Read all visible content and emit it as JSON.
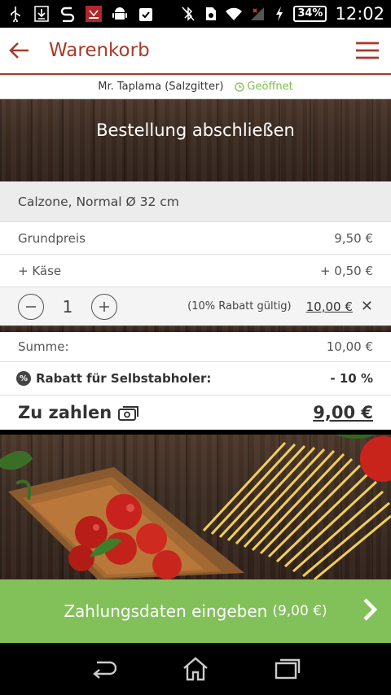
{
  "status_bar": {
    "left_icons": [
      "usb-icon",
      "download-icon",
      "s-app-icon",
      "app-logo-icon",
      "android-icon",
      "clipboard-check-icon"
    ],
    "battery": "34%",
    "time": "12:02"
  },
  "app_bar": {
    "title": "Warenkorb"
  },
  "store": {
    "name": "Mr. Taplama (Salzgitter)",
    "status": "Geöffnet"
  },
  "banner": {
    "title": "Bestellung abschließen"
  },
  "cart": {
    "item_name": "Calzone, Normal Ø 32 cm",
    "lines": [
      {
        "label": "Grundpreis",
        "value": "9,50 €"
      },
      {
        "label": "+ Käse",
        "value": "+ 0,50 €"
      }
    ],
    "quantity": "1",
    "rabatt_hint": "(10% Rabatt gültig)",
    "line_total": "10,00 €",
    "remove_symbol": "✕"
  },
  "summary": {
    "sum_label": "Summe:",
    "sum_value": "10,00 €",
    "discount_badge": "%",
    "discount_label": "Rabatt für Selbstabholer:",
    "discount_value": "- 10 %",
    "total_label": "Zu zahlen",
    "total_value": "9,00 €"
  },
  "cta": {
    "label": "Zahlungsdaten eingeben",
    "amount": "(9,00 €)"
  },
  "colors": {
    "brand": "#a83a2a",
    "cta": "#82c159",
    "open_status": "#7cc04a"
  }
}
